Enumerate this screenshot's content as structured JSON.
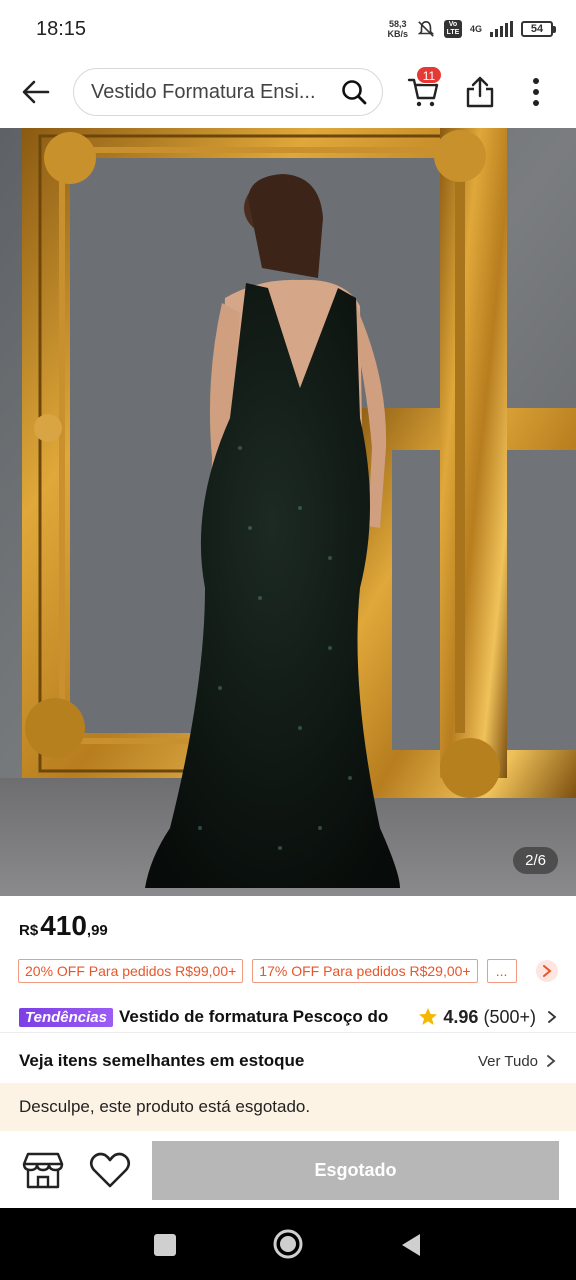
{
  "status": {
    "time": "18:15",
    "net_speed_value": "58,3",
    "net_speed_unit": "KB/s",
    "lte_label": "Vo LTE",
    "network": "4G",
    "battery": "54"
  },
  "header": {
    "search_text": "Vestido Formatura Ensi...",
    "cart_count": "11"
  },
  "gallery": {
    "page_indicator": "2/6",
    "current": 2,
    "total": 6
  },
  "product": {
    "currency": "R$",
    "price_int": "410",
    "price_dec": ",99",
    "coupons": [
      "20% OFF Para pedidos R$99,00+",
      "17% OFF Para pedidos R$29,00+",
      "..."
    ],
    "badge": "Tendências",
    "title": "Vestido de formatura Pescoço do",
    "rating": "4.96",
    "rating_count": "(500+)"
  },
  "similar": {
    "title": "Veja itens semelhantes em estoque",
    "see_all": "Ver Tudo"
  },
  "notice": {
    "soldout_message": "Desculpe, este produto está esgotado."
  },
  "actions": {
    "soldout_button": "Esgotado"
  },
  "colors": {
    "accent": "#e8552a",
    "badge_red": "#e53935",
    "trend_purple": "#7b3fe4",
    "disabled_button": "#b7b7b7",
    "notice_bg": "#fdf3e4",
    "star": "#f5b800"
  }
}
